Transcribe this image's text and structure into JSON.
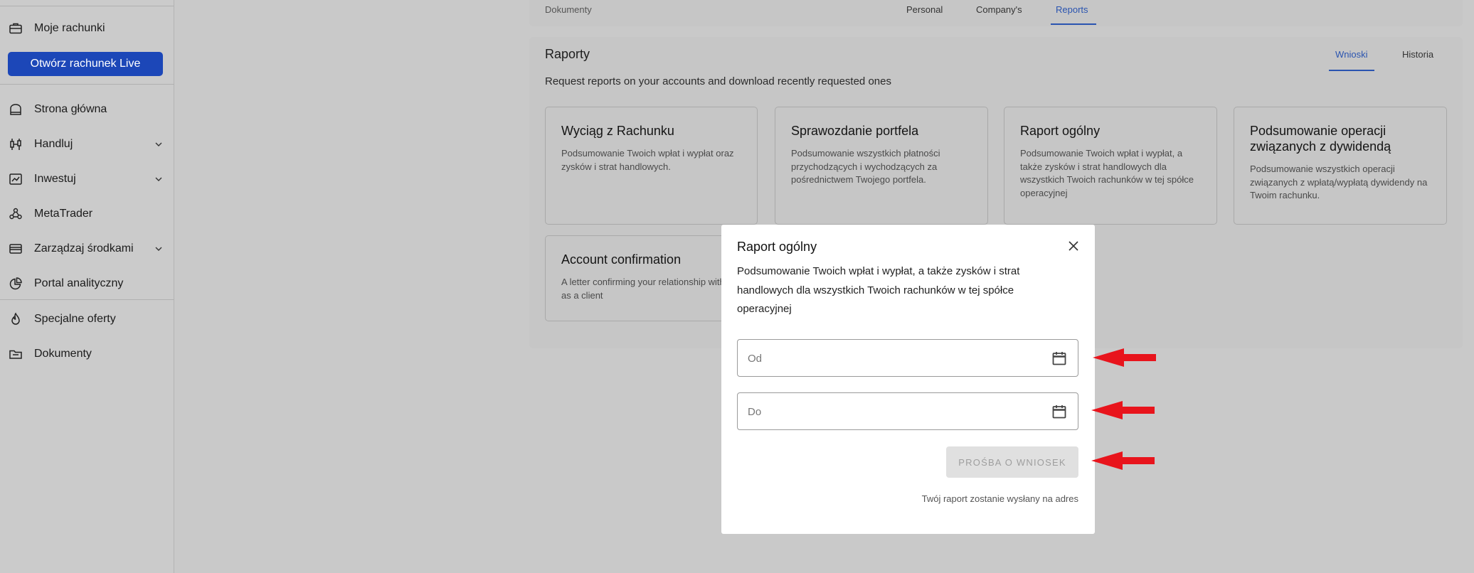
{
  "sidebar": {
    "items": [
      {
        "label": "Moje rachunki",
        "icon": "briefcase-icon"
      },
      {
        "label": "Strona główna",
        "icon": "home-icon"
      },
      {
        "label": "Handluj",
        "icon": "candlestick-icon"
      },
      {
        "label": "Inwestuj",
        "icon": "chart-line-icon"
      },
      {
        "label": "MetaTrader",
        "icon": "metatrader-icon"
      },
      {
        "label": "Zarządzaj środkami",
        "icon": "wallet-icon"
      },
      {
        "label": "Portal analityczny",
        "icon": "pie-chart-icon"
      },
      {
        "label": "Specjalne oferty",
        "icon": "flame-icon"
      },
      {
        "label": "Dokumenty",
        "icon": "folder-icon"
      }
    ],
    "live_button": "Otwórz rachunek Live"
  },
  "topbar": {
    "breadcrumb": "Dokumenty",
    "tabs": [
      "Personal",
      "Company's",
      "Reports"
    ],
    "active_tab": "Reports"
  },
  "reports": {
    "title": "Raporty",
    "subtitle": "Request reports on your accounts and download recently requested ones",
    "tabs": [
      "Wnioski",
      "Historia"
    ],
    "active_tab": "Wnioski",
    "cards": [
      {
        "title": "Wyciąg z Rachunku",
        "desc": "Podsumowanie Twoich wpłat i wypłat oraz zysków i strat handlowych."
      },
      {
        "title": "Sprawozdanie portfela",
        "desc": "Podsumowanie wszystkich płatności przychodzących i wychodzących za pośrednictwem Twojego portfela."
      },
      {
        "title": "Raport ogólny",
        "desc": "Podsumowanie Twoich wpłat i wypłat, a także zysków i strat handlowych dla wszystkich Twoich rachunków w tej spółce operacyjnej"
      },
      {
        "title": "Podsumowanie operacji związanych z dywidendą",
        "desc": "Podsumowanie wszystkich operacji związanych z wpłatą/wypłatą dywidendy na Twoim rachunku."
      },
      {
        "title": "Account confirmation",
        "desc": "A letter confirming your relationship with us as a client"
      }
    ]
  },
  "modal": {
    "title": "Raport ogólny",
    "description": "Podsumowanie Twoich wpłat i wypłat, a także zysków i strat handlowych dla wszystkich Twoich rachunków w tej spółce operacyjnej",
    "from_placeholder": "Od",
    "to_placeholder": "Do",
    "request_button": "PROŚBA O WNIOSEK",
    "footer": "Twój raport zostanie wysłany na adres"
  },
  "colors": {
    "accent": "#1c47b8",
    "annotation_arrow": "#e8141c"
  }
}
